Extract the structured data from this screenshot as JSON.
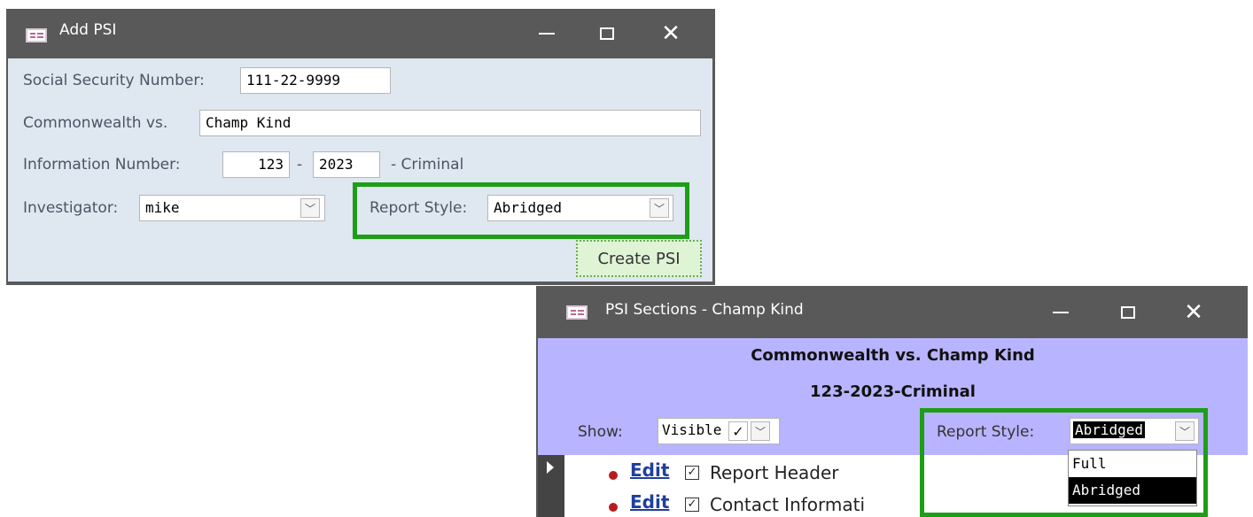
{
  "add_psi": {
    "title": "Add PSI",
    "ssn_label": "Social Security Number:",
    "ssn_value": "111-22-9999",
    "commonwealth_label": "Commonwealth vs.",
    "commonwealth_value": "Champ Kind",
    "info_label": "Information Number:",
    "info_num": "123",
    "info_dash": "-",
    "info_year": "2023",
    "info_suffix": "- Criminal",
    "investigator_label": "Investigator:",
    "investigator_value": "mike",
    "report_style_label": "Report Style:",
    "report_style_value": "Abridged",
    "create_button": "Create PSI"
  },
  "psi_sections": {
    "title": "PSI Sections - Champ Kind",
    "header_line1": "Commonwealth vs. Champ Kind",
    "header_line2": "123-2023-Criminal",
    "show_label": "Show:",
    "show_value": "Visible",
    "report_style_label": "Report Style:",
    "report_style_value": "Abridged",
    "dropdown_options": [
      "Full",
      "Abridged"
    ],
    "rows": [
      {
        "edit": "Edit",
        "label": "Report Header"
      },
      {
        "edit": "Edit",
        "label": "Contact Informati"
      }
    ]
  },
  "colors": {
    "titlebar": "#595959",
    "form_bg": "#dfe7f1",
    "section_header_bg": "#b8b4ff",
    "highlight": "#1e9e16",
    "create_btn_bg": "#dff3d5",
    "bullet": "#b81c1c",
    "link": "#1f3f9e"
  },
  "icons": [
    "form-icon",
    "minimize-icon",
    "maximize-icon",
    "close-icon",
    "chevron-down-icon",
    "checkbox-icon",
    "record-selector-icon"
  ]
}
